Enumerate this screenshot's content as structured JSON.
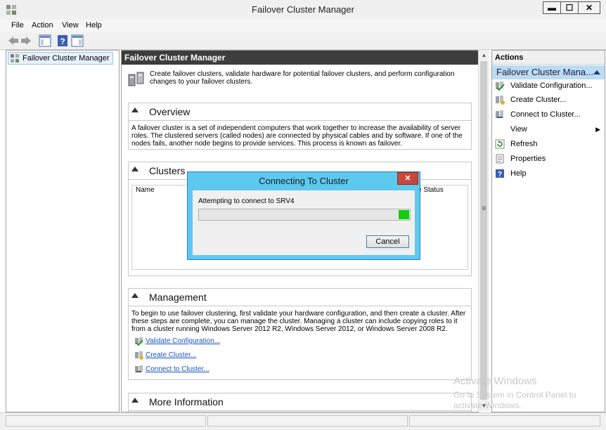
{
  "window": {
    "title": "Failover Cluster Manager",
    "icon": "cluster-manager-icon",
    "minimize": "▬",
    "maximize": "☐",
    "close": "✕"
  },
  "menubar": {
    "items": [
      "File",
      "Action",
      "View",
      "Help"
    ]
  },
  "toolbar": {
    "icons": [
      "back-arrow-icon",
      "forward-arrow-icon",
      "show-hide-console-tree-icon",
      "help-icon",
      "show-hide-action-pane-icon"
    ]
  },
  "tree": {
    "root": "Failover Cluster Manager"
  },
  "center": {
    "header": "Failover Cluster Manager",
    "intro": "Create failover clusters, validate hardware for potential failover clusters, and perform configuration changes to your failover clusters.",
    "overview": {
      "title": "Overview",
      "text": "A failover cluster is a set of independent computers that work together to increase the availability of server roles. The clustered servers (called nodes) are connected by physical cables and by software. If one of the nodes fails, another node begins to provide services. This process is known as failover."
    },
    "clusters": {
      "title": "Clusters",
      "columns": [
        "Name",
        "e Status"
      ]
    },
    "management": {
      "title": "Management",
      "text": "To begin to use failover clustering, first validate your hardware configuration, and then create a cluster.  After these steps are complete, you can manage the cluster. Managing a cluster can include copying roles to it from a cluster running Windows Server 2012 R2, Windows Server 2012, or Windows Server 2008 R2.",
      "links": [
        "Validate Configuration...",
        "Create Cluster...",
        "Connect to Cluster..."
      ]
    },
    "more_info": {
      "title": "More Information"
    }
  },
  "actions": {
    "title": "Actions",
    "group": "Failover Cluster Mana...",
    "items": [
      {
        "label": "Validate Configuration...",
        "icon": "validate-icon"
      },
      {
        "label": "Create Cluster...",
        "icon": "create-cluster-icon"
      },
      {
        "label": "Connect to Cluster...",
        "icon": "connect-cluster-icon"
      },
      {
        "label": "View",
        "icon": ""
      },
      {
        "label": "Refresh",
        "icon": "refresh-icon"
      },
      {
        "label": "Properties",
        "icon": "properties-icon"
      },
      {
        "label": "Help",
        "icon": "help-icon"
      }
    ],
    "submenu_arrow": "▶"
  },
  "dialog": {
    "title": "Connecting To Cluster",
    "close": "✕",
    "message": "Attempting to connect to SRV4",
    "progress": 0.05,
    "cancel": "Cancel"
  },
  "watermark": {
    "title": "Activate Windows",
    "subtitle": "Go to System in Control Panel to activate Windows."
  },
  "colors": {
    "header_dark": "#3d3d3d",
    "dialog_frame": "#5ec9ef",
    "progress_green": "#10cd10",
    "link_blue": "#1a52c8",
    "actions_group_bg": "#bcdcf4"
  }
}
